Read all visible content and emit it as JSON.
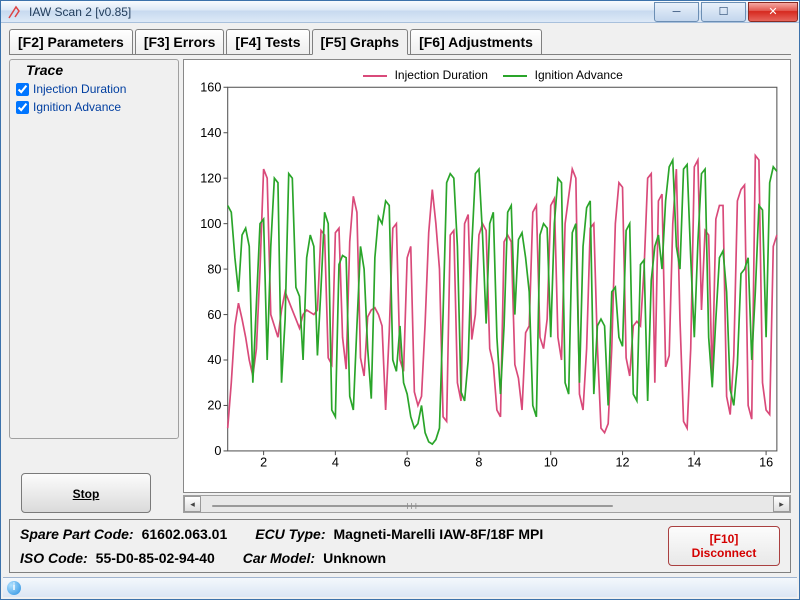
{
  "window": {
    "title": "IAW Scan 2 [v0.85]"
  },
  "tabs": [
    {
      "label": "[F2] Parameters"
    },
    {
      "label": "[F3] Errors"
    },
    {
      "label": "[F4] Tests"
    },
    {
      "label": "[F5] Graphs"
    },
    {
      "label": "[F6] Adjustments"
    }
  ],
  "trace": {
    "legend": "Trace",
    "items": [
      {
        "label": "Injection Duration",
        "checked": true
      },
      {
        "label": "Ignition Advance",
        "checked": true
      }
    ]
  },
  "stop_label": "Stop",
  "legend": {
    "a": {
      "label": "Injection Duration",
      "color": "#d94a7a"
    },
    "b": {
      "label": "Ignition Advance",
      "color": "#2aa52a"
    }
  },
  "status": {
    "spare_label": "Spare Part Code:",
    "spare_val": "61602.063.01",
    "ecu_label": "ECU Type:",
    "ecu_val": "Magneti-Marelli IAW-8F/18F MPI",
    "iso_label": "ISO Code:",
    "iso_val": "55-D0-85-02-94-40",
    "car_label": "Car Model:",
    "car_val": "Unknown"
  },
  "disconnect": {
    "line1": "[F10]",
    "line2": "Disconnect"
  },
  "chart_data": {
    "type": "line",
    "xlim": [
      1,
      16.3
    ],
    "ylim": [
      0,
      160
    ],
    "yticks": [
      0,
      20,
      40,
      60,
      80,
      100,
      120,
      140,
      160
    ],
    "xticks": [
      2,
      4,
      6,
      8,
      10,
      12,
      14,
      16
    ],
    "series": [
      {
        "name": "Injection Duration",
        "color": "#d94a7a",
        "x": [
          1,
          1.1,
          1.2,
          1.3,
          1.4,
          1.5,
          1.6,
          1.7,
          1.8,
          1.9,
          2,
          2.1,
          2.2,
          2.3,
          2.4,
          2.5,
          2.6,
          2.7,
          2.8,
          2.9,
          3,
          3.1,
          3.2,
          3.3,
          3.4,
          3.5,
          3.6,
          3.7,
          3.8,
          3.9,
          4,
          4.1,
          4.2,
          4.3,
          4.4,
          4.5,
          4.6,
          4.7,
          4.8,
          4.9,
          5,
          5.1,
          5.2,
          5.3,
          5.4,
          5.5,
          5.6,
          5.7,
          5.8,
          5.9,
          6,
          6.1,
          6.2,
          6.3,
          6.4,
          6.5,
          6.6,
          6.7,
          6.8,
          6.9,
          7,
          7.1,
          7.2,
          7.3,
          7.4,
          7.5,
          7.6,
          7.7,
          7.8,
          7.9,
          8,
          8.1,
          8.2,
          8.3,
          8.4,
          8.5,
          8.6,
          8.7,
          8.8,
          8.9,
          9,
          9.1,
          9.2,
          9.3,
          9.4,
          9.5,
          9.6,
          9.7,
          9.8,
          9.9,
          10,
          10.1,
          10.2,
          10.3,
          10.4,
          10.5,
          10.6,
          10.7,
          10.8,
          10.9,
          11,
          11.1,
          11.2,
          11.3,
          11.4,
          11.5,
          11.6,
          11.7,
          11.8,
          11.9,
          12,
          12.1,
          12.2,
          12.3,
          12.4,
          12.5,
          12.6,
          12.7,
          12.8,
          12.9,
          13,
          13.1,
          13.2,
          13.3,
          13.4,
          13.5,
          13.6,
          13.7,
          13.8,
          13.9,
          14,
          14.1,
          14.2,
          14.3,
          14.4,
          14.5,
          14.6,
          14.7,
          14.8,
          14.9,
          15,
          15.1,
          15.2,
          15.3,
          15.4,
          15.5,
          15.6,
          15.7,
          15.8,
          15.9,
          16,
          16.1,
          16.2,
          16.3
        ],
        "y": [
          10,
          30,
          55,
          65,
          58,
          50,
          40,
          33,
          45,
          80,
          124,
          120,
          60,
          55,
          50,
          62,
          70,
          66,
          62,
          58,
          54,
          60,
          62,
          61,
          60,
          62,
          97,
          95,
          41,
          38,
          96,
          98,
          50,
          36,
          92,
          112,
          105,
          41,
          33,
          59,
          62,
          63,
          60,
          55,
          18,
          52,
          98,
          100,
          40,
          35,
          85,
          90,
          26,
          20,
          24,
          56,
          96,
          115,
          100,
          80,
          15,
          13,
          95,
          97,
          30,
          22,
          100,
          104,
          49,
          60,
          95,
          100,
          97,
          45,
          38,
          18,
          15,
          92,
          95,
          92,
          38,
          32,
          18,
          52,
          55,
          105,
          108,
          50,
          45,
          58,
          108,
          111,
          50,
          40,
          100,
          112,
          124,
          120,
          25,
          18,
          45,
          98,
          100,
          46,
          10,
          8,
          12,
          45,
          100,
          118,
          116,
          41,
          33,
          55,
          57,
          55,
          80,
          120,
          122,
          30,
          110,
          113,
          37,
          42,
          100,
          124,
          58,
          13,
          10,
          45,
          125,
          128,
          62,
          97,
          95,
          30,
          102,
          108,
          108,
          24,
          16,
          42,
          110,
          115,
          117,
          20,
          14,
          130,
          128,
          30,
          18,
          16,
          90,
          95
        ]
      },
      {
        "name": "Ignition Advance",
        "color": "#2aa52a",
        "x": [
          1,
          1.1,
          1.2,
          1.3,
          1.4,
          1.5,
          1.6,
          1.7,
          1.8,
          1.9,
          2,
          2.1,
          2.2,
          2.3,
          2.4,
          2.5,
          2.6,
          2.7,
          2.8,
          2.9,
          3,
          3.1,
          3.2,
          3.3,
          3.4,
          3.5,
          3.6,
          3.7,
          3.8,
          3.9,
          4,
          4.1,
          4.2,
          4.3,
          4.4,
          4.5,
          4.6,
          4.7,
          4.8,
          4.9,
          5,
          5.1,
          5.2,
          5.3,
          5.4,
          5.5,
          5.6,
          5.7,
          5.8,
          5.9,
          6,
          6.1,
          6.2,
          6.3,
          6.4,
          6.5,
          6.6,
          6.7,
          6.8,
          6.9,
          7,
          7.1,
          7.2,
          7.3,
          7.4,
          7.5,
          7.6,
          7.7,
          7.8,
          7.9,
          8,
          8.1,
          8.2,
          8.3,
          8.4,
          8.5,
          8.6,
          8.7,
          8.8,
          8.9,
          9,
          9.1,
          9.2,
          9.3,
          9.4,
          9.5,
          9.6,
          9.7,
          9.8,
          9.9,
          10,
          10.1,
          10.2,
          10.3,
          10.4,
          10.5,
          10.6,
          10.7,
          10.8,
          10.9,
          11,
          11.1,
          11.2,
          11.3,
          11.4,
          11.5,
          11.6,
          11.7,
          11.8,
          11.9,
          12,
          12.1,
          12.2,
          12.3,
          12.4,
          12.5,
          12.6,
          12.7,
          12.8,
          12.9,
          13,
          13.1,
          13.2,
          13.3,
          13.4,
          13.5,
          13.6,
          13.7,
          13.8,
          13.9,
          14,
          14.1,
          14.2,
          14.3,
          14.4,
          14.5,
          14.6,
          14.7,
          14.8,
          14.9,
          15,
          15.1,
          15.2,
          15.3,
          15.4,
          15.5,
          15.6,
          15.7,
          15.8,
          15.9,
          16,
          16.1,
          16.2,
          16.3
        ],
        "y": [
          108,
          105,
          85,
          70,
          95,
          98,
          90,
          30,
          65,
          100,
          102,
          40,
          90,
          120,
          118,
          30,
          58,
          122,
          120,
          72,
          68,
          40,
          85,
          95,
          90,
          42,
          72,
          105,
          100,
          18,
          15,
          82,
          86,
          85,
          24,
          18,
          55,
          90,
          80,
          45,
          23,
          85,
          103,
          100,
          110,
          108,
          40,
          35,
          55,
          30,
          25,
          15,
          10,
          12,
          20,
          8,
          4,
          3,
          5,
          10,
          60,
          118,
          122,
          120,
          90,
          26,
          22,
          40,
          90,
          122,
          124,
          95,
          56,
          100,
          105,
          50,
          25,
          55,
          105,
          108,
          60,
          93,
          96,
          85,
          70,
          20,
          15,
          95,
          100,
          98,
          50,
          100,
          120,
          118,
          30,
          25,
          96,
          100,
          30,
          90,
          107,
          110,
          25,
          55,
          58,
          55,
          20,
          70,
          72,
          50,
          46,
          97,
          100,
          25,
          22,
          82,
          84,
          22,
          75,
          90,
          95,
          80,
          110,
          125,
          128,
          90,
          80,
          124,
          126,
          85,
          50,
          92,
          122,
          124,
          50,
          28,
          58,
          85,
          88,
          70,
          27,
          20,
          38,
          78,
          80,
          85,
          40,
          70,
          108,
          106,
          50,
          118,
          125,
          123
        ]
      }
    ]
  }
}
